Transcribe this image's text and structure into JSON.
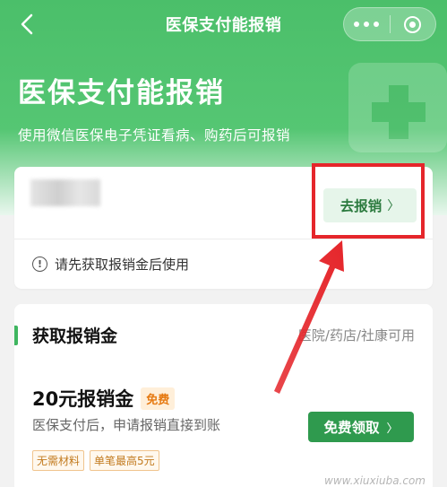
{
  "nav": {
    "title": "医保支付能报销"
  },
  "hero": {
    "title": "医保支付能报销",
    "subtitle": "使用微信医保电子凭证看病、购药后可报销"
  },
  "account_card": {
    "action_label": "去报销",
    "notice": "请先获取报销金后使用"
  },
  "reimburse_section": {
    "title": "获取报销金",
    "scope": "医院/药店/社康可用",
    "amount": "20元报销金",
    "badge": "免费",
    "description": "医保支付后，申请报销直接到账",
    "claim_label": "免费领取",
    "chips": [
      "无需材料",
      "单笔最高5元"
    ]
  },
  "watermark": "www.xiuxiuba.com",
  "colors": {
    "brand_green": "#4bbf6a",
    "button_green": "#2f9a4e",
    "annotation_red": "#e5262b",
    "badge_orange": "#e67a12"
  },
  "icons": [
    "back-icon",
    "more-dots-icon",
    "mini-program-close-icon",
    "info-icon",
    "chevron-right-icon"
  ]
}
